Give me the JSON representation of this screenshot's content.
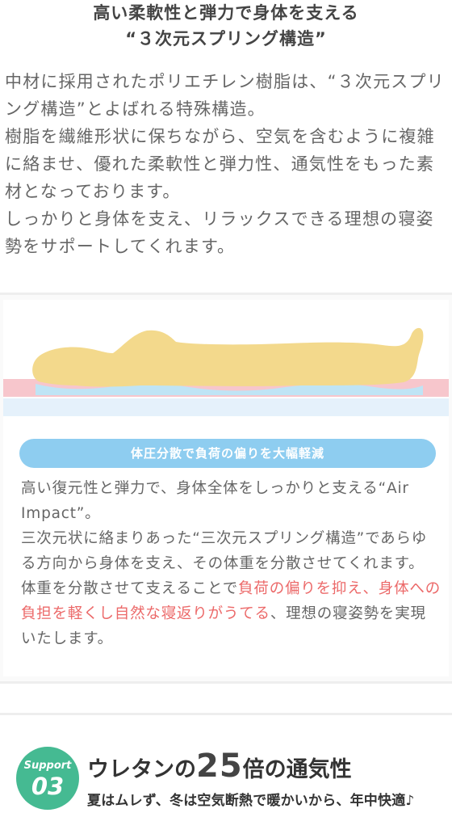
{
  "heading": {
    "line1": "高い柔軟性と弾力で身体を支える",
    "line2": "“３次元スプリング構造”"
  },
  "intro": {
    "p1": "中材に採用されたポリエチレン樹脂は、“３次元スプリング構造”とよばれる特殊構造。",
    "p2": "樹脂を繊維形状に保ちながら、空気を含むように複雑に絡ませ、優れた柔軟性と弾力性、通気性をもった素材となっております。",
    "p3": "しっかりと身体を支え、リラックスできる理想の寝姿勢をサポートしてくれます。"
  },
  "figure": {
    "colors": {
      "body": "#f3d98c",
      "pink_layer": "#f7c6cc",
      "blue_wave": "#bfe4f5",
      "base_layer": "#e5f1fb"
    }
  },
  "panel": {
    "pill_label": "体圧分散で負荷の偏りを大幅軽減",
    "desc_p1": "高い復元性と弾力で、身体全体をしっかりと支える“Air Impact”。",
    "desc_p2": "三次元状に絡まりあった“三次元スプリング構造”であらゆる方向から身体を支え、その体重を分散させてくれます。",
    "desc_p3_before": "体重を分散させて支えることで",
    "desc_p3_highlight": "負荷の偏りを抑え、身体への負担を軽くし自然な寝返りがうてる",
    "desc_p3_after": "、理想の寝姿勢を実現いたします。"
  },
  "support": {
    "badge_label": "Support",
    "badge_number": "03",
    "title_before": "ウレタンの",
    "title_number": "25",
    "title_after": "倍の通気性",
    "subtitle": "夏はムレず、冬は空気断熱で暖かいから、年中快適♪",
    "accent_color": "#45ba92"
  }
}
